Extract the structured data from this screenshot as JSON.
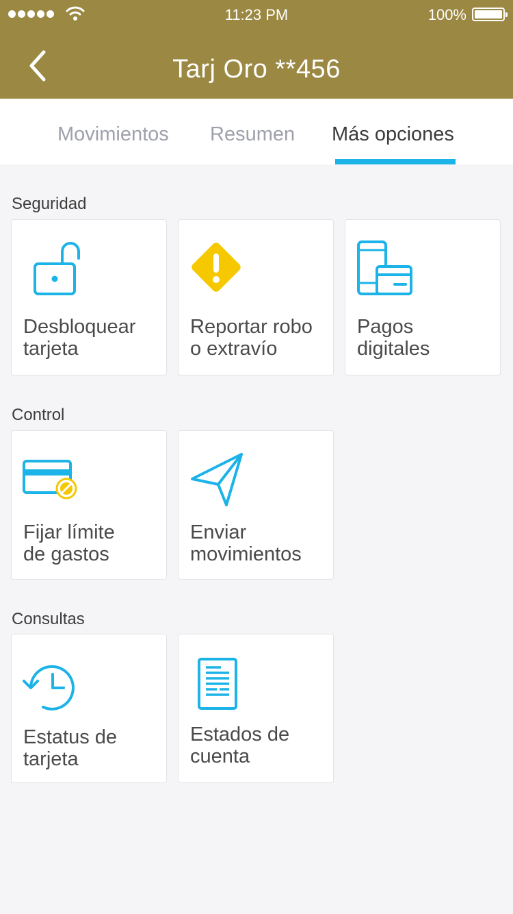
{
  "status_bar": {
    "time": "11:23 PM",
    "battery": "100%"
  },
  "header": {
    "title": "Tarj Oro **456"
  },
  "tabs": [
    {
      "label": "Movimientos",
      "active": false
    },
    {
      "label": "Resumen",
      "active": false
    },
    {
      "label": "Más opciones",
      "active": true
    }
  ],
  "sections": [
    {
      "label": "Seguridad",
      "cards": [
        {
          "label": "Desbloquear\ntarjeta",
          "icon": "unlock-icon"
        },
        {
          "label": "Reportar robo\no extravío",
          "icon": "warning-icon"
        },
        {
          "label": "Pagos\ndigitales",
          "icon": "phone-card-icon"
        }
      ]
    },
    {
      "label": "Control",
      "cards": [
        {
          "label": "Fijar límite\nde gastos",
          "icon": "card-limit-icon"
        },
        {
          "label": "Enviar\nmovimientos",
          "icon": "send-icon"
        }
      ]
    },
    {
      "label": "Consultas",
      "cards": [
        {
          "label": "Estatus de\ntarjeta",
          "icon": "history-icon"
        },
        {
          "label": "Estados de\ncuenta",
          "icon": "document-icon"
        }
      ]
    }
  ],
  "colors": {
    "header": "#9a8843",
    "accent": "#1bb3e8",
    "warning": "#f5c800"
  }
}
